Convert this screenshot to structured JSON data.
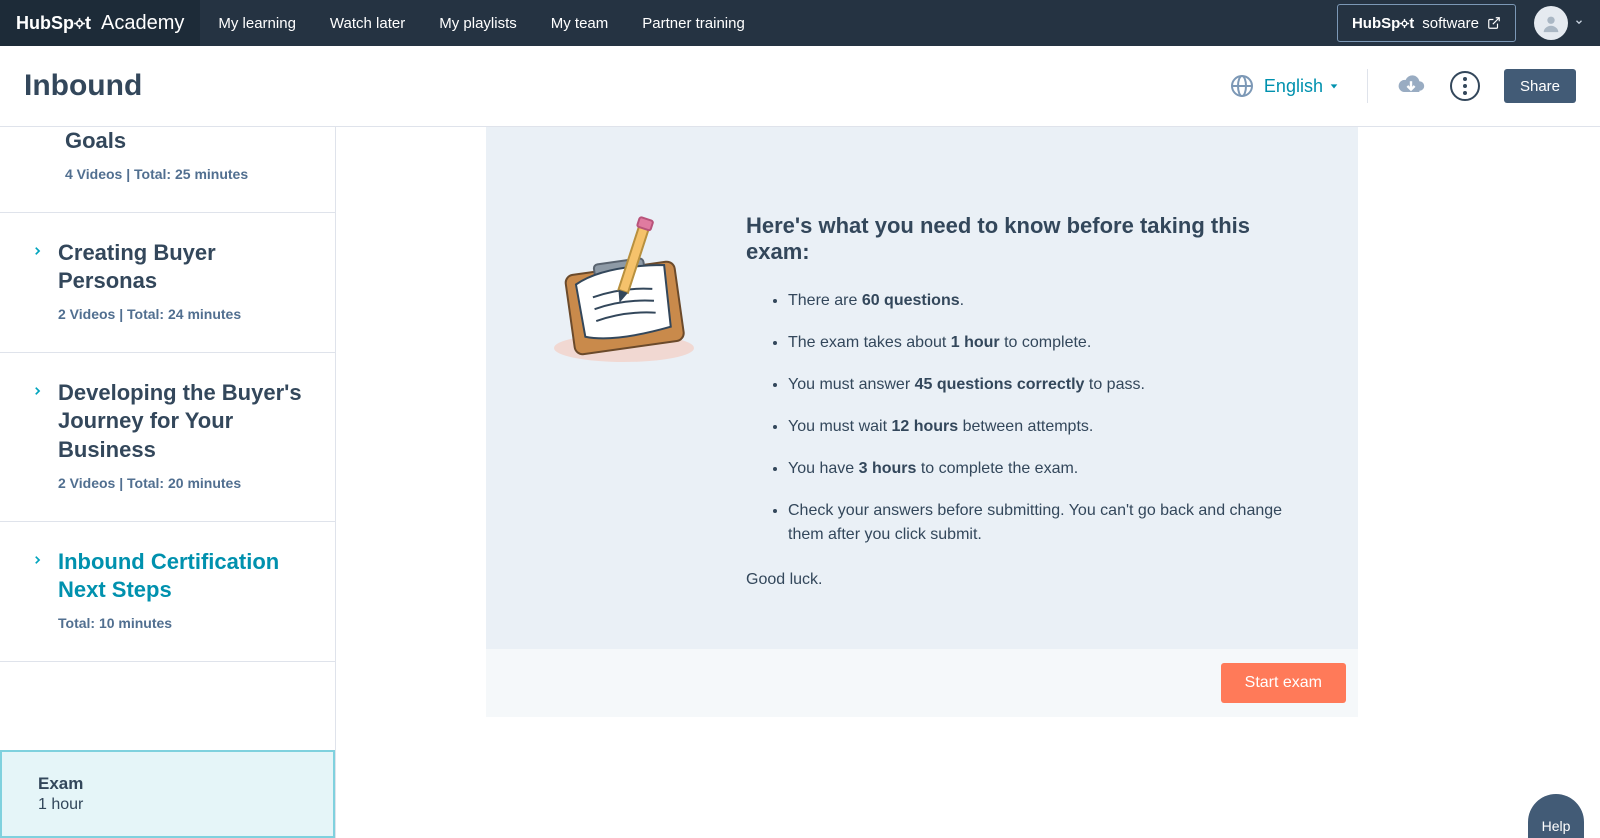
{
  "brand": {
    "logo_text": "HubSpot",
    "academy": "Academy"
  },
  "nav": {
    "links": [
      "My learning",
      "Watch later",
      "My playlists",
      "My team",
      "Partner training"
    ],
    "software": "HubSpot software"
  },
  "subbar": {
    "title": "Inbound",
    "language": "English",
    "share": "Share"
  },
  "sidebar": {
    "items": [
      {
        "title": "Goals",
        "meta": "4 Videos | Total: 25 minutes",
        "teal": false,
        "chevron": false
      },
      {
        "title": "Creating Buyer Personas",
        "meta": "2 Videos | Total: 24 minutes",
        "teal": false,
        "chevron": true
      },
      {
        "title": "Developing the Buyer's Journey for Your Business",
        "meta": "2 Videos | Total: 20 minutes",
        "teal": false,
        "chevron": true
      },
      {
        "title": "Inbound Certification Next Steps",
        "meta": "Total: 10 minutes",
        "teal": true,
        "chevron": true
      }
    ],
    "exam": {
      "title": "Exam",
      "duration": "1 hour"
    }
  },
  "exam_info": {
    "heading": "Here's what you need to know before taking this exam:",
    "bullets": [
      {
        "pre": "There are ",
        "bold": "60 questions",
        "post": "."
      },
      {
        "pre": "The exam takes about ",
        "bold": "1 hour",
        "post": " to complete."
      },
      {
        "pre": "You must answer ",
        "bold": "45 questions correctly",
        "post": " to pass."
      },
      {
        "pre": "You must wait ",
        "bold": "12 hours",
        "post": " between attempts."
      },
      {
        "pre": "You have ",
        "bold": "3 hours",
        "post": " to complete the exam."
      },
      {
        "pre": "Check your answers before submitting. You can't go back and change them after you click submit.",
        "bold": "",
        "post": ""
      }
    ],
    "goodluck": "Good luck.",
    "start": "Start exam"
  },
  "help": "Help"
}
